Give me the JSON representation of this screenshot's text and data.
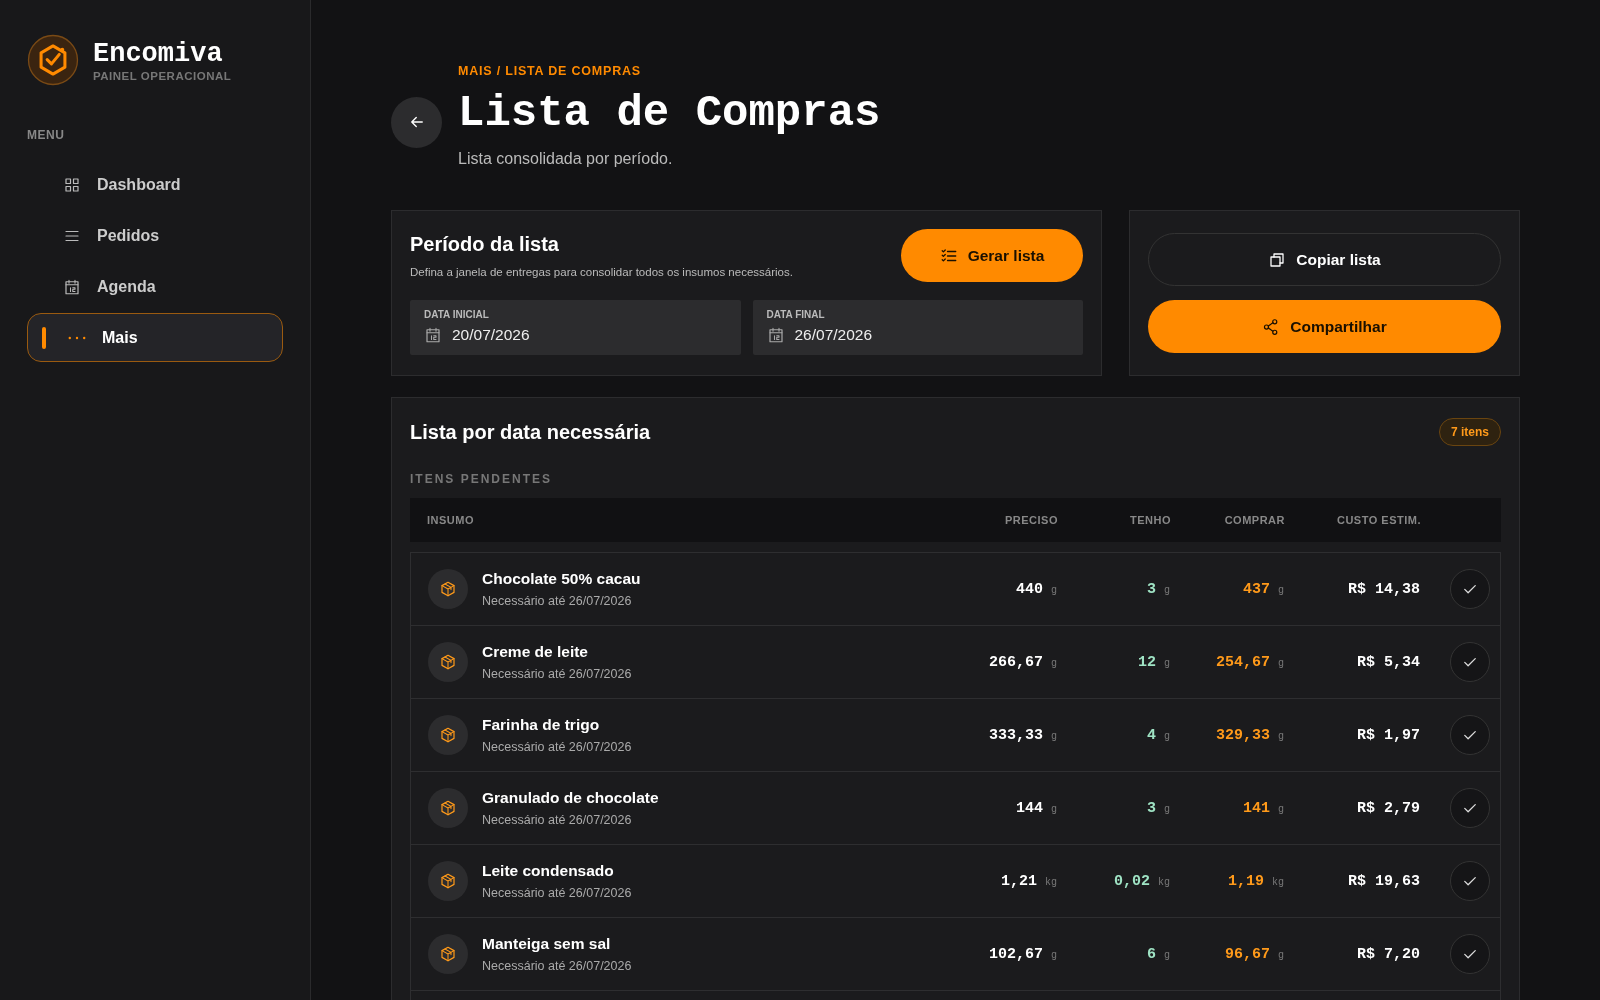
{
  "brand": {
    "name": "Encomiva",
    "tagline": "PAINEL OPERACIONAL"
  },
  "sidebar": {
    "heading": "MENU",
    "items": [
      {
        "label": "Dashboard",
        "selected": false
      },
      {
        "label": "Pedidos",
        "selected": false
      },
      {
        "label": "Agenda",
        "selected": false
      },
      {
        "label": "Mais",
        "selected": true
      }
    ]
  },
  "header": {
    "breadcrumb": "MAIS / LISTA DE COMPRAS",
    "title": "Lista de Compras",
    "subtitle": "Lista consolidada por período."
  },
  "period": {
    "title": "Período da lista",
    "description": "Defina a janela de entregas para consolidar todos os insumos necessários.",
    "button": "Gerar lista",
    "fields": [
      {
        "label": "DATA INICIAL",
        "value": "20/07/2026"
      },
      {
        "label": "DATA FINAL",
        "value": "26/07/2026"
      }
    ]
  },
  "actions": {
    "copy": "Copiar lista",
    "share": "Compartilhar"
  },
  "list": {
    "title": "Lista por data necessária",
    "count": "7 itens",
    "section": "ITENS PENDENTES",
    "columns": [
      "INSUMO",
      "PRECISO",
      "TENHO",
      "COMPRAR",
      "CUSTO ESTIM."
    ],
    "rows": [
      {
        "name": "Chocolate 50% cacau",
        "note": "Necessário até 26/07/2026",
        "need": "440",
        "need_unit": "g",
        "have": "3",
        "have_unit": "g",
        "buy": "437",
        "buy_unit": "g",
        "cost": "R$ 14,38"
      },
      {
        "name": "Creme de leite",
        "note": "Necessário até 26/07/2026",
        "need": "266,67",
        "need_unit": "g",
        "have": "12",
        "have_unit": "g",
        "buy": "254,67",
        "buy_unit": "g",
        "cost": "R$ 5,34"
      },
      {
        "name": "Farinha de trigo",
        "note": "Necessário até 26/07/2026",
        "need": "333,33",
        "need_unit": "g",
        "have": "4",
        "have_unit": "g",
        "buy": "329,33",
        "buy_unit": "g",
        "cost": "R$ 1,97"
      },
      {
        "name": "Granulado de chocolate",
        "note": "Necessário até 26/07/2026",
        "need": "144",
        "need_unit": "g",
        "have": "3",
        "have_unit": "g",
        "buy": "141",
        "buy_unit": "g",
        "cost": "R$ 2,79"
      },
      {
        "name": "Leite condensado",
        "note": "Necessário até 26/07/2026",
        "need": "1,21",
        "need_unit": "kg",
        "have": "0,02",
        "have_unit": "kg",
        "buy": "1,19",
        "buy_unit": "kg",
        "cost": "R$ 19,63"
      },
      {
        "name": "Manteiga sem sal",
        "note": "Necessário até 26/07/2026",
        "need": "102,67",
        "need_unit": "g",
        "have": "6",
        "have_unit": "g",
        "buy": "96,67",
        "buy_unit": "g",
        "cost": "R$ 7,20"
      }
    ]
  }
}
